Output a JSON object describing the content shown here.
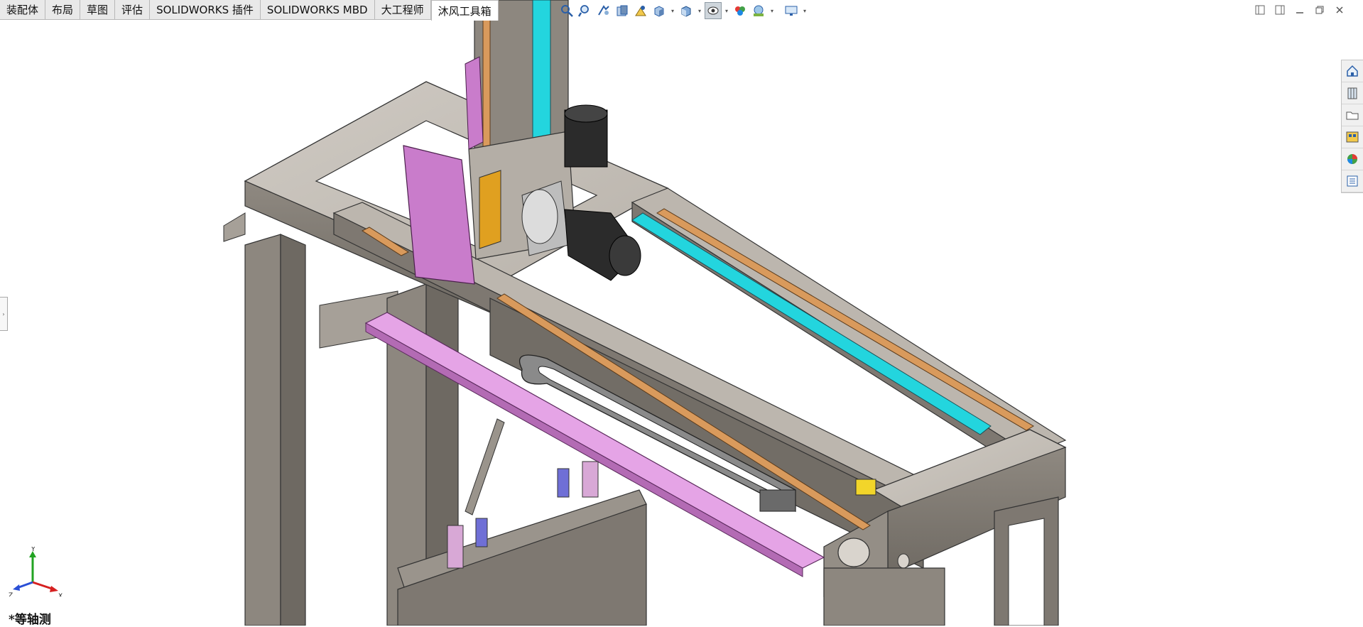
{
  "tabs": [
    {
      "label": "装配体",
      "active": false
    },
    {
      "label": "布局",
      "active": false
    },
    {
      "label": "草图",
      "active": false
    },
    {
      "label": "评估",
      "active": false
    },
    {
      "label": "SOLIDWORKS 插件",
      "active": false
    },
    {
      "label": "SOLIDWORKS MBD",
      "active": false
    },
    {
      "label": "大工程师",
      "active": false
    },
    {
      "label": "沐风工具箱",
      "active": true
    }
  ],
  "hud_icons": [
    "zoom-to-fit-icon",
    "zoom-to-area-icon",
    "previous-view-icon",
    "section-view-icon",
    "dynamic-annotation-icon",
    "view-orientation-icon",
    "display-style-icon",
    "hide-show-items-icon",
    "edit-appearance-icon",
    "apply-scene-icon",
    "view-settings-icon"
  ],
  "task_pane_icons": [
    "solidworks-resources-icon",
    "design-library-icon",
    "file-explorer-icon",
    "view-palette-icon",
    "appearances-icon",
    "custom-properties-icon"
  ],
  "triad": {
    "x_label": "X",
    "y_label": "Y",
    "z_label": "Z",
    "x_color": "#d62020",
    "y_color": "#22a322",
    "z_color": "#2a4fd6"
  },
  "view": {
    "name": "*等轴测"
  },
  "colors": {
    "steel": "#9e9890",
    "steel_light": "#c8c3bc",
    "steel_dark": "#6e6962",
    "magenta": "#d78ad8",
    "cyan": "#23d5de",
    "copper": "#d99a5c",
    "motor": "#2b2b2b",
    "drag_chain": "#8a8a8a"
  }
}
